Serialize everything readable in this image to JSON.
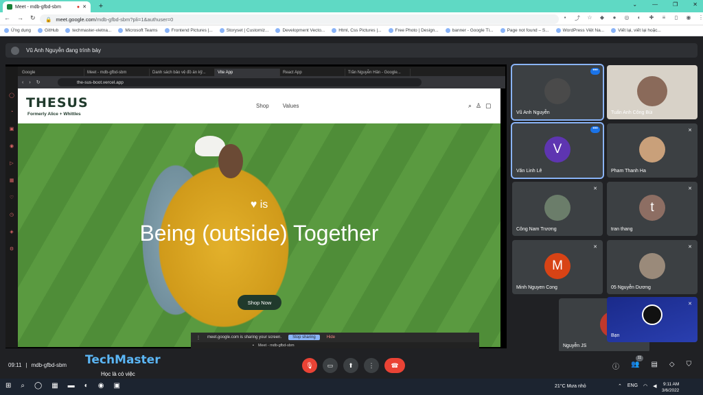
{
  "browser": {
    "tab_title": "Meet - mdb-gfbd-sbm",
    "url_host": "meet.google.com",
    "url_path": "/mdb-gfbd-sbm?pli=1&authuser=0",
    "bookmarks": [
      "Ứng dụng",
      "GitHub",
      "techmaster-vietna...",
      "Microsoft Teams",
      "Frontend Pictures |...",
      "Storyset | Customiz...",
      "Development Vecto...",
      "Html, Css Pictures |...",
      "Free Photo | Design...",
      "banner - Google Tì...",
      "Page not found – S...",
      "WordPress Việt Na...",
      "Viết lại, viết lại hoặc..."
    ]
  },
  "meet": {
    "presenter_text": "Vũ Anh Nguyễn đang trình bày",
    "meeting_time": "09:11",
    "meeting_code": "mdb-gfbd-sbm",
    "participant_count": "11",
    "participants": [
      {
        "name": "Vũ Anh Nguyễn",
        "initial": "",
        "color": "#4a4a4a"
      },
      {
        "name": "Tuấn Anh Công Bùi",
        "initial": "",
        "color": "#8a6a5a"
      },
      {
        "name": "Văn Linh Lê",
        "initial": "V",
        "color": "#5e35b1"
      },
      {
        "name": "Pham Thanh Ha",
        "initial": "",
        "color": "#c9a07a"
      },
      {
        "name": "Công Nam Trương",
        "initial": "",
        "color": "#6b7d6a"
      },
      {
        "name": "tran thang",
        "initial": "t",
        "color": "#8d6e63"
      },
      {
        "name": "Minh Nguyen Cong",
        "initial": "M",
        "color": "#d84315"
      },
      {
        "name": "05 Nguyễn Dương",
        "initial": "",
        "color": "#9a8a7a"
      },
      {
        "name": "Nguyễn JS",
        "initial": "",
        "color": "#c0392b"
      },
      {
        "name": "Bạn",
        "initial": "",
        "color": "#222"
      }
    ]
  },
  "shared": {
    "tabs": [
      "Google",
      "Meet - mdb-gfbd-sbm",
      "Danh sách bảo vệ đồ án kỹ...",
      "Vite App",
      "React App",
      "Trần Nguyễn Hân - Google..."
    ],
    "url": "the-sus-boot.vercel.app",
    "logo": "THESUS",
    "logo_sub": "Formerly Alice + Whittles",
    "nav": [
      "Shop",
      "Values"
    ],
    "hero_kicker": "♥ is",
    "hero_title": "Being (outside) Together",
    "cta": "Shop Now",
    "share_text": "meet.google.com is sharing your screen.",
    "stop_label": "Stop sharing",
    "hide_label": "Hide",
    "mini_tab": "Meet - mdb-gfbd-sbm"
  },
  "branding": {
    "name": "TechMaster",
    "tagline": "Học là có việc"
  },
  "taskbar": {
    "weather": "21°C  Mưa nhỏ",
    "lang": "ENG",
    "time": "9:11 AM",
    "date": "3/6/2022"
  }
}
